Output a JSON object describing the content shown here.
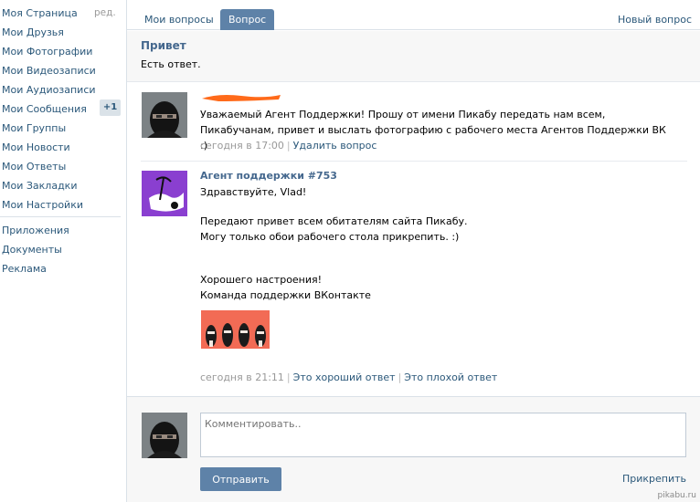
{
  "sidebar": {
    "items": [
      {
        "label": "Моя Страница"
      },
      {
        "label": "Мои Друзья"
      },
      {
        "label": "Мои Фотографии"
      },
      {
        "label": "Мои Видеозаписи"
      },
      {
        "label": "Мои Аудиозаписи"
      },
      {
        "label": "Мои Сообщения"
      },
      {
        "label": "Мои Группы"
      },
      {
        "label": "Мои Новости"
      },
      {
        "label": "Мои Ответы"
      },
      {
        "label": "Мои Закладки"
      },
      {
        "label": "Мои Настройки"
      }
    ],
    "edit_label": "ред.",
    "messages_badge": "+1",
    "extra": [
      {
        "label": "Приложения"
      },
      {
        "label": "Документы"
      },
      {
        "label": "Реклама"
      }
    ]
  },
  "tabs": {
    "my_questions": "Мои вопросы",
    "question": "Вопрос",
    "new_question": "Новый вопрос"
  },
  "question": {
    "title": "Привет",
    "status": "Есть ответ."
  },
  "user_post": {
    "text": "Уважаемый Агент Поддержки! Прошу от имени Пикабу передать нам всем, Пикабучанам, привет и выслать фотографию с рабочего места Агентов Поддержки ВК :)",
    "time": "сегодня в 17:00",
    "delete_label": "Удалить вопрос"
  },
  "agent_post": {
    "name": "Агент поддержки #753",
    "greeting": "Здравствуйте, Vlad!",
    "line1": "Передают привет всем обитателям сайта Пикабу.",
    "line2": "Могу только обои рабочего стола прикрепить. :)",
    "closing1": "Хорошего настроения!",
    "closing2": "Команда поддержки ВКонтакте",
    "time": "сегодня в 21:11",
    "good_label": "Это хороший ответ",
    "bad_label": "Это плохой ответ"
  },
  "comment": {
    "placeholder": "Комментировать..",
    "send_label": "Отправить",
    "attach_label": "Прикрепить"
  },
  "watermark": "pikabu.ru",
  "colors": {
    "link": "#2b587a",
    "accent": "#5e82a8",
    "agent_avatar_bg": "#8a3fd0",
    "redaction": "#ff6a1a",
    "wallpaper_bg": "#f26b55"
  }
}
